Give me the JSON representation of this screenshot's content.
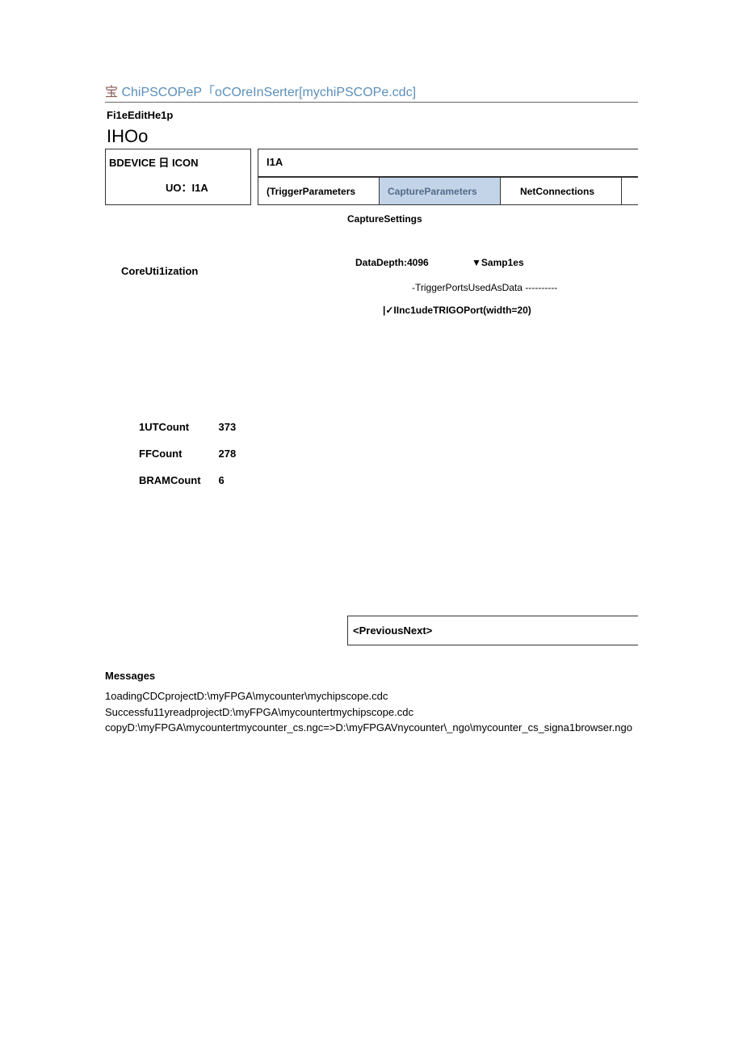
{
  "window": {
    "title_prefix": "宝 ",
    "title": "ChiPSCOPeP「oCOreInSerter[mychiPSCOPe.cdc]"
  },
  "menubar": {
    "text": "Fi1eEditHe1p"
  },
  "toolbar": {
    "text": "IHOo"
  },
  "tree": {
    "root": "BDEVICE 日 ICON",
    "child": "UO：I1A"
  },
  "right": {
    "unit": "I1A",
    "tabs": {
      "trigger": "(TriggerParameters",
      "capture": "CaptureParameters",
      "net": "NetConnections"
    }
  },
  "capture": {
    "header": "CaptureSettings",
    "data_depth_label": "DataDepth:4096",
    "samples_label": "▼Samp1es",
    "trigger_ports": "-TriggerPortsUsedAsData ----------",
    "include_trig": "|✓IInc1udeTRIGOPort(width=20)"
  },
  "core_util": {
    "header": "CoreUti1ization",
    "rows": [
      {
        "label": "1UTCount",
        "value": "373"
      },
      {
        "label": "FFCount",
        "value": "278"
      },
      {
        "label": "BRAMCount",
        "value": "6"
      }
    ]
  },
  "nav": {
    "text": "<PreviousNext>"
  },
  "messages": {
    "header": "Messages",
    "lines": [
      "1oadingCDCprojectD:\\myFPGA\\mycounter\\mychipscope.cdc",
      "Successfu11yreadprojectD:\\myFPGA\\mycountertmychipscope.cdc",
      "copyD:\\myFPGA\\mycountertmycounter_cs.ngc=>D:\\myFPGAVnycounter\\_ngo\\mycounter_cs_signa1browser.ngo"
    ]
  }
}
